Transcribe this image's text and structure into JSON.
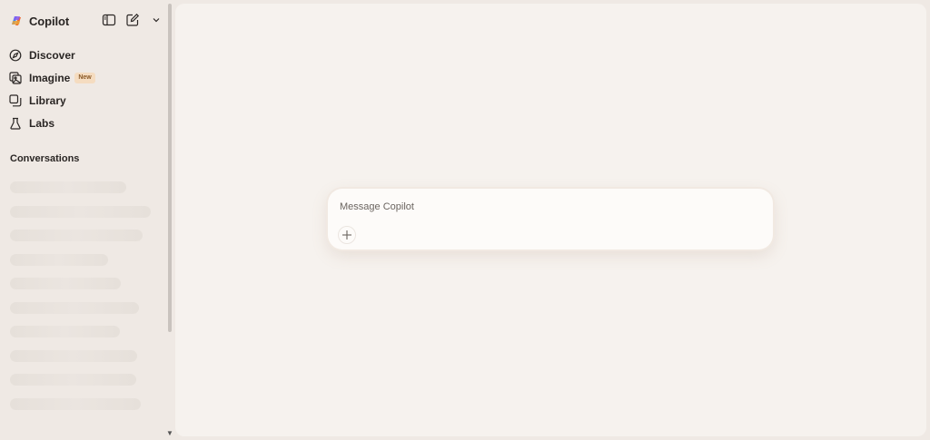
{
  "app": {
    "name": "Copilot"
  },
  "sidebar": {
    "items": [
      {
        "label": "Discover",
        "icon": "compass-icon"
      },
      {
        "label": "Imagine",
        "icon": "image-icon",
        "badge": "New"
      },
      {
        "label": "Library",
        "icon": "library-icon"
      },
      {
        "label": "Labs",
        "icon": "flask-icon"
      }
    ],
    "conversations_title": "Conversations",
    "skeleton_rows": 10
  },
  "composer": {
    "placeholder": "Message Copilot"
  },
  "colors": {
    "badge_bg": "#f5dcc0",
    "badge_text": "#8a5a28",
    "background": "#efe9e4",
    "main_bg": "#f6f2ee"
  }
}
